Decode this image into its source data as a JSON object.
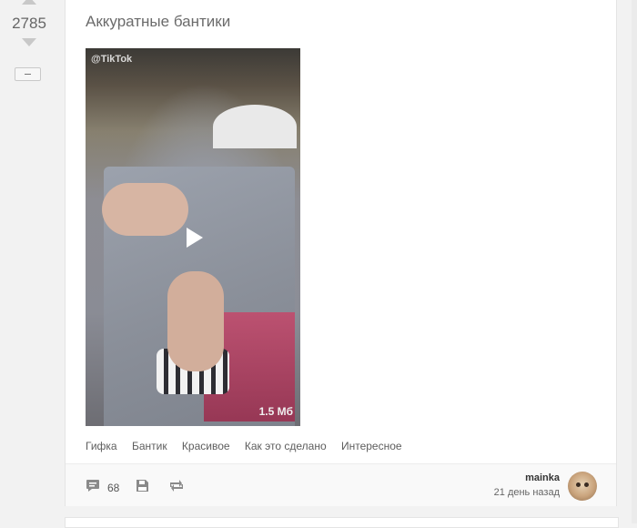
{
  "post": {
    "rating": "2785",
    "title": "Аккуратные бантики",
    "video": {
      "watermark": "@TikTok",
      "size": "1.5 Мб"
    },
    "tags": [
      "Гифка",
      "Бантик",
      "Красивое",
      "Как это сделано",
      "Интересное"
    ],
    "comments_count": "68",
    "author": {
      "name": "mainka",
      "time": "21 день назад"
    }
  },
  "colors": {
    "background": "#f2f2f2",
    "card": "#ffffff",
    "title": "#6b6b6b",
    "icon": "#8a8a8a"
  },
  "icons": {
    "vote_up": "triangle-up",
    "vote_down": "triangle-down",
    "collapse": "minus",
    "comments": "speech-bubble",
    "save": "floppy-disk",
    "share": "repost-arrows",
    "play": "play-triangle"
  }
}
